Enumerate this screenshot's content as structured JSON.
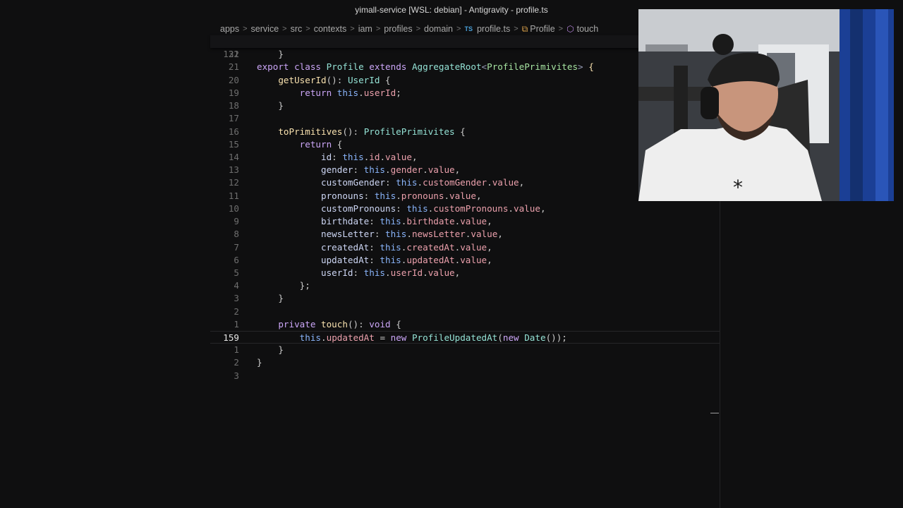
{
  "window": {
    "title": "yimall-service [WSL: debian] - Antigravity - profile.ts"
  },
  "breadcrumb": {
    "items": [
      "apps",
      "service",
      "src",
      "contexts",
      "iam",
      "profiles",
      "domain"
    ],
    "file_badge": "TS",
    "file": "profile.ts",
    "class": "Profile",
    "method": "touch"
  },
  "editor": {
    "sticky": {
      "line_number": "131",
      "text": "export class Profile extends AggregateRoot<ProfilePrimivites> {"
    },
    "lines": [
      {
        "n": "22",
        "text": "    }"
      },
      {
        "n": "21",
        "text": ""
      },
      {
        "n": "20",
        "text": "    getUserId(): UserId {"
      },
      {
        "n": "19",
        "text": "        return this.userId;"
      },
      {
        "n": "18",
        "text": "    }"
      },
      {
        "n": "17",
        "text": ""
      },
      {
        "n": "16",
        "text": "    toPrimitives(): ProfilePrimivites {"
      },
      {
        "n": "15",
        "text": "        return {"
      },
      {
        "n": "14",
        "text": "            id: this.id.value,"
      },
      {
        "n": "13",
        "text": "            gender: this.gender.value,"
      },
      {
        "n": "12",
        "text": "            customGender: this.customGender.value,"
      },
      {
        "n": "11",
        "text": "            pronouns: this.pronouns.value,"
      },
      {
        "n": "10",
        "text": "            customPronouns: this.customPronouns.value,"
      },
      {
        "n": "9",
        "text": "            birthdate: this.birthdate.value,"
      },
      {
        "n": "8",
        "text": "            newsLetter: this.newsLetter.value,"
      },
      {
        "n": "7",
        "text": "            createdAt: this.createdAt.value,"
      },
      {
        "n": "6",
        "text": "            updatedAt: this.updatedAt.value,"
      },
      {
        "n": "5",
        "text": "            userId: this.userId.value,"
      },
      {
        "n": "4",
        "text": "        };"
      },
      {
        "n": "3",
        "text": "    }"
      },
      {
        "n": "2",
        "text": ""
      },
      {
        "n": "1",
        "text": "    private touch(): void {"
      },
      {
        "n": "159",
        "text": "        this.updatedAt = new ProfileUpdatedAt(new Date());",
        "current": true
      },
      {
        "n": "1",
        "text": "    }"
      },
      {
        "n": "2",
        "text": "}"
      },
      {
        "n": "3",
        "text": ""
      }
    ]
  },
  "webcam": {
    "label": "webcam-overlay"
  }
}
